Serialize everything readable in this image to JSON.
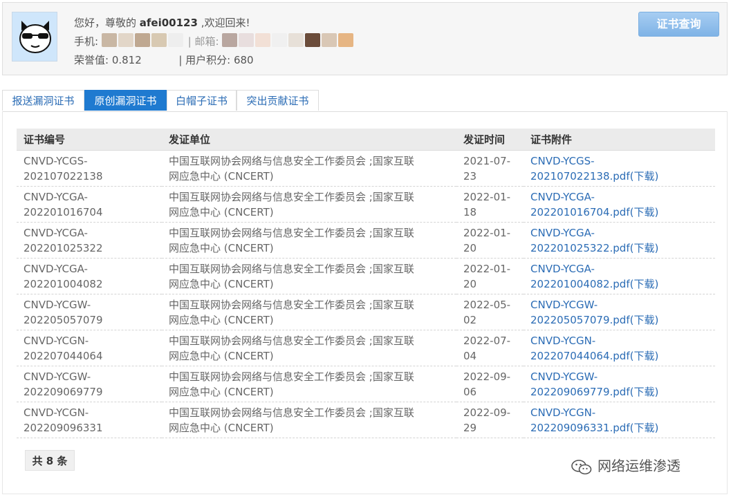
{
  "header": {
    "greeting_prefix": "您好，尊敬的 ",
    "username": "afei00123",
    "greeting_suffix": " ,欢迎回来!",
    "phone_label": "手机:",
    "email_label": "| 邮箱:",
    "honor_label": "荣誉值: 0.812",
    "points_label": "| 用户积分: 680",
    "query_button": "证书查询"
  },
  "tabs": [
    {
      "label": "报送漏洞证书"
    },
    {
      "label": "原创漏洞证书"
    },
    {
      "label": "白帽子证书"
    },
    {
      "label": "突出贡献证书"
    }
  ],
  "table": {
    "headers": [
      "证书编号",
      "发证单位",
      "发证时间",
      "证书附件"
    ],
    "rows": [
      {
        "id_1": "CNVD-YCGS-",
        "id_2": "202107022138",
        "unit_1": "中国互联网协会网络与信息安全工作委员会 ;国家互联",
        "unit_2": "网应急中心 (CNCERT)",
        "date_1": "2021-07-",
        "date_2": "23",
        "file_1": "CNVD-YCGS-",
        "file_2": "202107022138.pdf(下载)"
      },
      {
        "id_1": "CNVD-YCGA-",
        "id_2": "202201016704",
        "unit_1": "中国互联网协会网络与信息安全工作委员会 ;国家互联",
        "unit_2": "网应急中心 (CNCERT)",
        "date_1": "2022-01-",
        "date_2": "18",
        "file_1": "CNVD-YCGA-",
        "file_2": "202201016704.pdf(下载)"
      },
      {
        "id_1": "CNVD-YCGA-",
        "id_2": "202201025322",
        "unit_1": "中国互联网协会网络与信息安全工作委员会 ;国家互联",
        "unit_2": "网应急中心 (CNCERT)",
        "date_1": "2022-01-",
        "date_2": "20",
        "file_1": "CNVD-YCGA-",
        "file_2": "202201025322.pdf(下载)"
      },
      {
        "id_1": "CNVD-YCGA-",
        "id_2": "202201004082",
        "unit_1": "中国互联网协会网络与信息安全工作委员会 ;国家互联",
        "unit_2": "网应急中心 (CNCERT)",
        "date_1": "2022-01-",
        "date_2": "20",
        "file_1": "CNVD-YCGA-",
        "file_2": "202201004082.pdf(下载)"
      },
      {
        "id_1": "CNVD-YCGW-",
        "id_2": "202205057079",
        "unit_1": "中国互联网协会网络与信息安全工作委员会 ;国家互联",
        "unit_2": "网应急中心 (CNCERT)",
        "date_1": "2022-05-",
        "date_2": "02",
        "file_1": "CNVD-YCGW-",
        "file_2": "202205057079.pdf(下载)"
      },
      {
        "id_1": "CNVD-YCGN-",
        "id_2": "202207044064",
        "unit_1": "中国互联网协会网络与信息安全工作委员会 ;国家互联",
        "unit_2": "网应急中心 (CNCERT)",
        "date_1": "2022-07-",
        "date_2": "04",
        "file_1": "CNVD-YCGN-",
        "file_2": "202207044064.pdf(下载)"
      },
      {
        "id_1": "CNVD-YCGW-",
        "id_2": "202209069779",
        "unit_1": "中国互联网协会网络与信息安全工作委员会 ;国家互联",
        "unit_2": "网应急中心 (CNCERT)",
        "date_1": "2022-09-",
        "date_2": "06",
        "file_1": "CNVD-YCGW-",
        "file_2": "202209069779.pdf(下载)"
      },
      {
        "id_1": "CNVD-YCGN-",
        "id_2": "202209096331",
        "unit_1": "中国互联网协会网络与信息安全工作委员会 ;国家互联",
        "unit_2": "网应急中心 (CNCERT)",
        "date_1": "2022-09-",
        "date_2": "29",
        "file_1": "CNVD-YCGN-",
        "file_2": "202209096331.pdf(下载)"
      }
    ]
  },
  "footer": {
    "total": "共 8 条",
    "watermark": "网络运维渗透"
  },
  "colors": {
    "active_tab": "#1f7ad0",
    "link": "#2b6cb5",
    "query_button": "#8fbfec"
  }
}
